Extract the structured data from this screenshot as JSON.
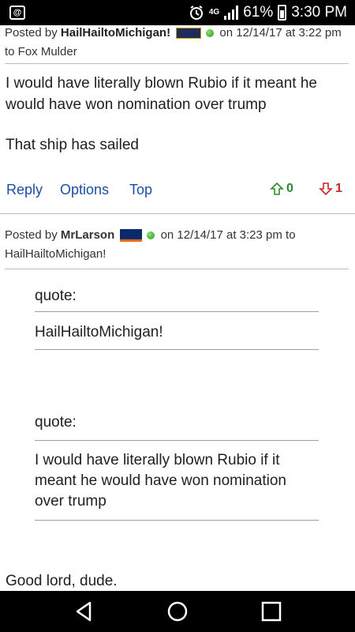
{
  "status_bar": {
    "notification_icon": "at-sign-icon",
    "network": "4G",
    "battery": "61%",
    "time": "3:30 PM"
  },
  "post1": {
    "posted_by_label": "Posted by",
    "author": "HailHailtoMichigan!",
    "date": "on 12/14/17 at 3:22 pm",
    "reply_to": "to Fox Mulder",
    "body_line1": "I would have literally blown Rubio if it meant he would have won nomination over trump",
    "body_line2": "That ship has sailed",
    "actions": {
      "reply": "Reply",
      "options": "Options",
      "top": "Top"
    },
    "upvotes": "0",
    "downvotes": "1"
  },
  "post2": {
    "posted_by_label": "Posted by",
    "author": "MrLarson",
    "date": "on 12/14/17 at 3:23 pm to",
    "reply_to": "HailHailtoMichigan!",
    "quote1": {
      "label": "quote:",
      "text": "HailHailtoMichigan!"
    },
    "quote2": {
      "label": "quote:",
      "text": "I would have literally blown Rubio if it meant he would have won nomination over trump"
    },
    "body": "Good lord, dude."
  },
  "nav": {
    "back": "back-icon",
    "home": "home-icon",
    "recents": "recents-icon"
  },
  "colors": {
    "link": "#1a4fa3",
    "upvote": "#2e8b2e",
    "downvote": "#c62828"
  }
}
